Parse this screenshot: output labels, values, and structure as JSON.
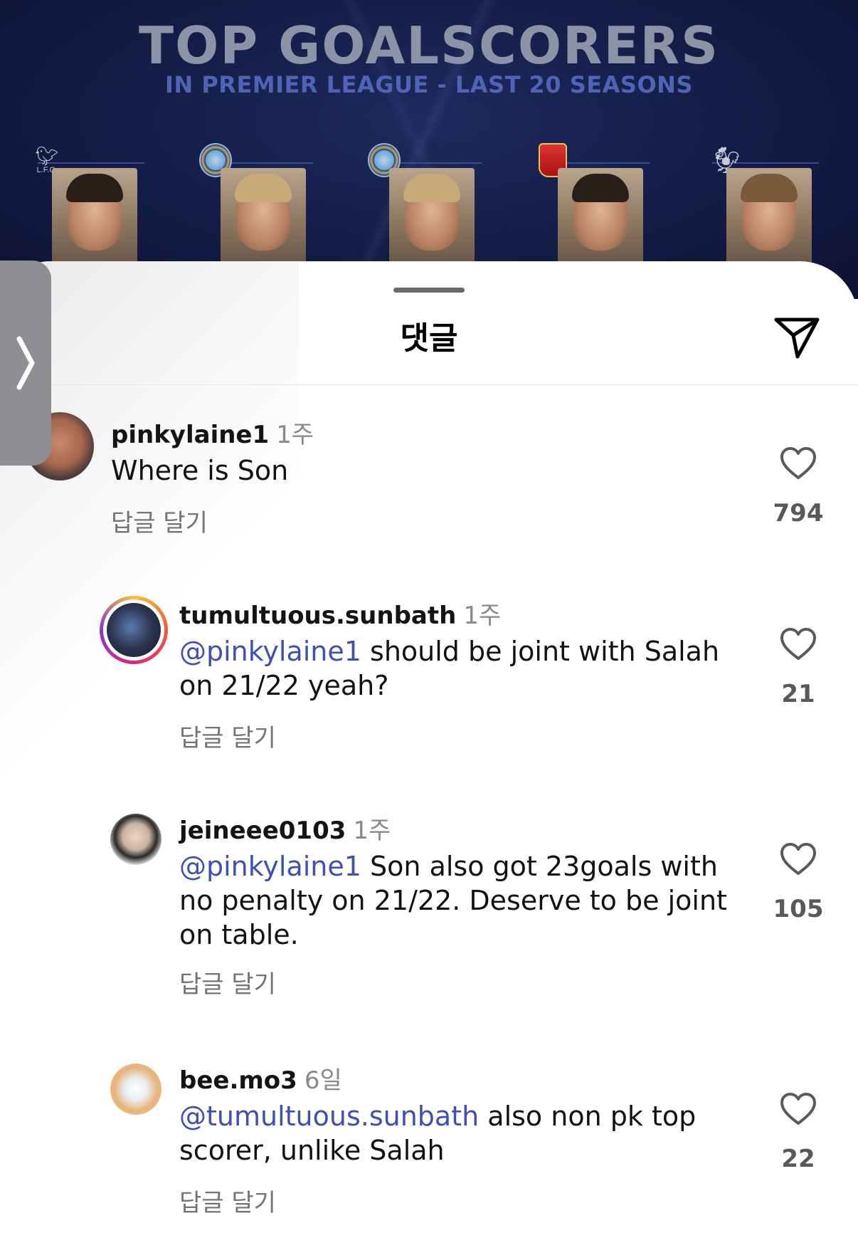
{
  "post_image": {
    "title": "TOP GOALSCORERS",
    "subtitle": "IN PREMIER LEAGUE - LAST 20 SEASONS",
    "crest_labels": [
      "L.F.C."
    ]
  },
  "sheet": {
    "title": "댓글"
  },
  "comments": [
    {
      "username": "pinkylaine1",
      "time": "1주",
      "mention": "",
      "text": "Where is Son",
      "reply_label": "답글 달기",
      "likes": "794"
    },
    {
      "username": "tumultuous.sunbath",
      "time": "1주",
      "mention": "@pinkylaine1",
      "text": " should be joint with Salah on 21/22 yeah?",
      "reply_label": "답글 달기",
      "likes": "21"
    },
    {
      "username": "jeineee0103",
      "time": "1주",
      "mention": "@pinkylaine1",
      "text": " Son also got 23goals with no penalty on 21/22. Deserve to be joint on table.",
      "reply_label": "답글 달기",
      "likes": "105"
    },
    {
      "username": "bee.mo3",
      "time": "6일",
      "mention": "@tumultuous.sunbath",
      "text": " also non pk top scorer, unlike Salah",
      "reply_label": "답글 달기",
      "likes": "22"
    }
  ],
  "icons": {
    "share": "paper-plane-icon",
    "like": "heart-outline-icon",
    "side_handle": "chevron-right-icon"
  },
  "colors": {
    "mention": "#3f4fb5",
    "muted_text": "#737378",
    "post_background": "#131c45"
  }
}
